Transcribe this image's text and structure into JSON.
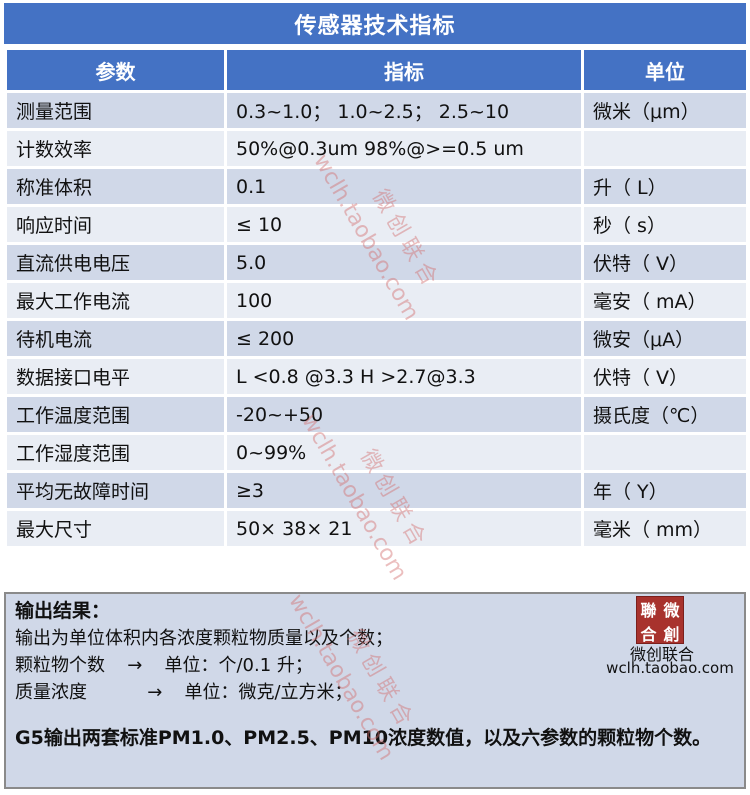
{
  "title": "传感器技术指标",
  "headers": [
    "参数",
    "指标",
    "单位"
  ],
  "rows": [
    [
      "测量范围",
      "0.3~1.0； 1.0~2.5； 2.5~10",
      "微米（μm）"
    ],
    [
      "计数效率",
      "50%@0.3um 98%@>=0.5 um",
      ""
    ],
    [
      "称准体积",
      "0.1",
      "升（ L）"
    ],
    [
      "响应时间",
      "≤ 10",
      "秒（ s）"
    ],
    [
      "直流供电电压",
      "5.0",
      "伏特（ V）"
    ],
    [
      "最大工作电流",
      "100",
      "毫安（ mA）"
    ],
    [
      "待机电流",
      "≤ 200",
      "微安（μA）"
    ],
    [
      "数据接口电平",
      "L <0.8 @3.3 H >2.7@3.3",
      "伏特（ V）"
    ],
    [
      "工作温度范围",
      "-20~+50",
      "摄氏度（℃）"
    ],
    [
      "工作湿度范围",
      "0~99%",
      ""
    ],
    [
      "平均无故障时间",
      "≥3",
      "年（ Y）"
    ],
    [
      "最大尺寸",
      "50× 38× 21",
      "毫米（ mm）"
    ]
  ],
  "result": {
    "title": "输出结果：",
    "line1": "输出为单位体积内各浓度颗粒物质量以及个数；",
    "line2_label": "颗粒物个数",
    "line2_arrow": "→",
    "line2_unit": "单位：个/0.1 升；",
    "line3_label": "质量浓度",
    "line3_arrow": "→",
    "line3_unit": "单位：微克/立方米；",
    "summary": "G5输出两套标准PM1.0、PM2.5、PM10浓度数值，以及六参数的颗粒物个数。"
  },
  "logo": {
    "stamp_chars": [
      "聯",
      "微",
      "合",
      "創"
    ],
    "name": "微创联合",
    "url": "wclh.taobao.com"
  },
  "watermark": {
    "url": "wclh.taobao.com",
    "cn": "微创联合"
  },
  "colors": {
    "header": "#4472c4",
    "row_odd": "#d0d8e8",
    "row_even": "#e9edf4",
    "stamp": "#a8322d"
  }
}
